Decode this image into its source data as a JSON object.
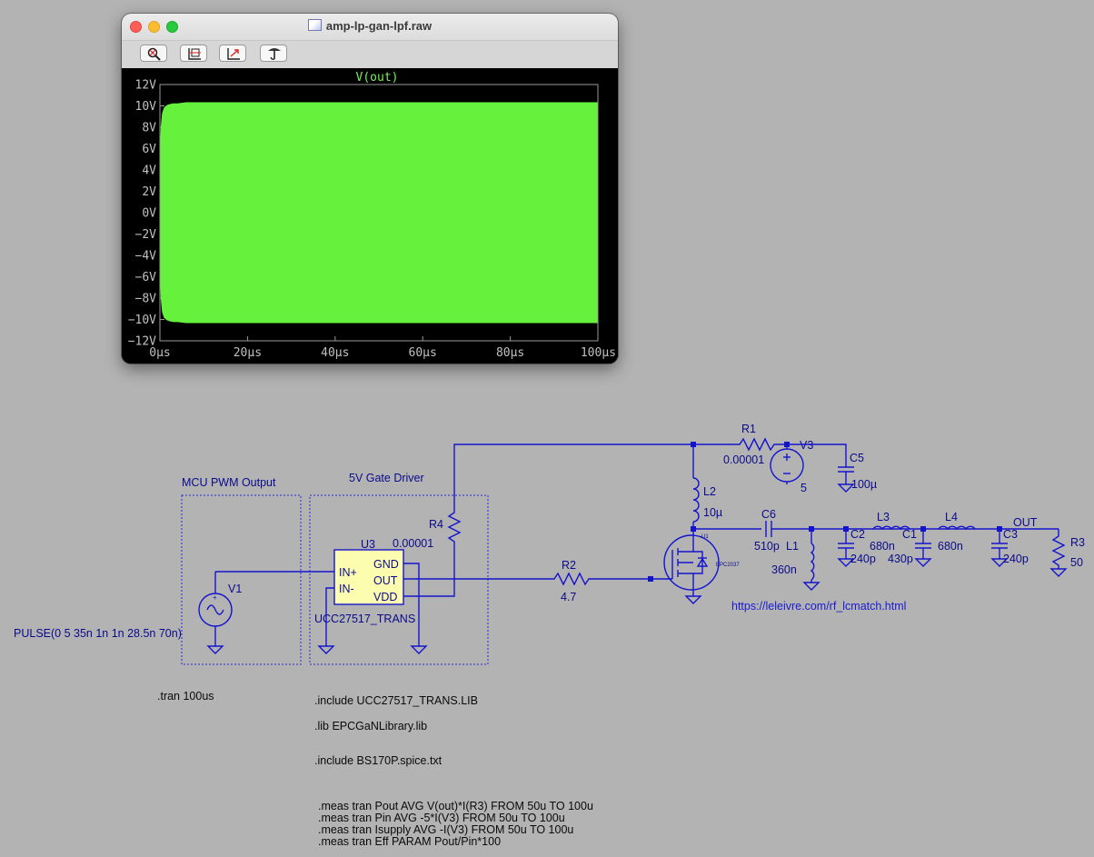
{
  "window": {
    "title": "amp-lp-gan-lpf.raw",
    "toolbar_icons": [
      "zoom-icon",
      "autorange-icon",
      "pan-icon",
      "probe-icon"
    ]
  },
  "colors": {
    "trace": "#66f23c",
    "plot_bg": "#000000",
    "wire": "#1414cc",
    "text": "#0a0a8c"
  },
  "chart_data": {
    "type": "area",
    "title": "V(out)",
    "xlabel": "",
    "ylabel": "",
    "x_ticks": [
      "0µs",
      "20µs",
      "40µs",
      "60µs",
      "80µs",
      "100µs"
    ],
    "y_ticks": [
      "12V",
      "10V",
      "8V",
      "6V",
      "4V",
      "2V",
      "0V",
      "−2V",
      "−4V",
      "−6V",
      "−8V",
      "−10V",
      "−12V"
    ],
    "xlim": [
      0,
      100
    ],
    "ylim": [
      -12,
      12
    ],
    "grid": false,
    "series": [
      {
        "name": "V(out)",
        "envelope": {
          "t": [
            0,
            0.3,
            0.6,
            1.0,
            1.5,
            2.0,
            3.0,
            4.0,
            6.0,
            100
          ],
          "upper": [
            4.5,
            8.0,
            9.3,
            9.8,
            10.0,
            10.1,
            10.2,
            10.2,
            10.3,
            10.3
          ],
          "lower": [
            -4.5,
            -8.0,
            -9.3,
            -9.8,
            -10.0,
            -10.1,
            -10.2,
            -10.2,
            -10.3,
            -10.3
          ]
        }
      }
    ]
  },
  "schematic": {
    "groups": {
      "mcu": "MCU PWM Output",
      "driver": "5V Gate Driver"
    },
    "v1": {
      "name": "V1",
      "value": "PULSE(0 5 35n 1n 1n 28.5n 70n)"
    },
    "u3": {
      "name": "U3",
      "model": "UCC27517_TRANS",
      "pins": [
        "IN+",
        "IN-",
        "GND",
        "OUT",
        "VDD"
      ]
    },
    "r4": {
      "name": "R4",
      "value": "0.00001"
    },
    "r1": {
      "name": "R1",
      "value": "0.00001"
    },
    "v3": {
      "name": "V3",
      "value": "5"
    },
    "c5": {
      "name": "C5",
      "value": "100µ"
    },
    "l2": {
      "name": "L2",
      "value": "10µ"
    },
    "r2": {
      "name": "R2",
      "value": "4.7"
    },
    "u1": {
      "name": "U1",
      "model": "EPC2037"
    },
    "c6": {
      "name": "C6",
      "value": "510p"
    },
    "l1": {
      "name": "L1",
      "value": "360n"
    },
    "c2": {
      "name": "C2",
      "value": "240p"
    },
    "l3": {
      "name": "L3",
      "value": "680n"
    },
    "c1": {
      "name": "C1",
      "value": "430p"
    },
    "l4": {
      "name": "L4",
      "value": "680n"
    },
    "c3": {
      "name": "C3",
      "value": "240p"
    },
    "r3": {
      "name": "R3",
      "value": "50"
    },
    "out_label": "OUT",
    "link": "https://leleivre.com/rf_lcmatch.html"
  },
  "directives": {
    "tran": ".tran 100us",
    "include1": ".include UCC27517_TRANS.LIB",
    "lib": ".lib EPCGaNLibrary.lib",
    "include2": ".include BS170P.spice.txt",
    "meas1": ".meas tran Pout AVG V(out)*I(R3) FROM 50u TO 100u",
    "meas2": ".meas tran Pin AVG -5*I(V3) FROM 50u TO 100u",
    "meas3": ".meas tran Isupply AVG -I(V3) FROM 50u TO 100u",
    "meas4": ".meas tran Eff PARAM Pout/Pin*100"
  }
}
